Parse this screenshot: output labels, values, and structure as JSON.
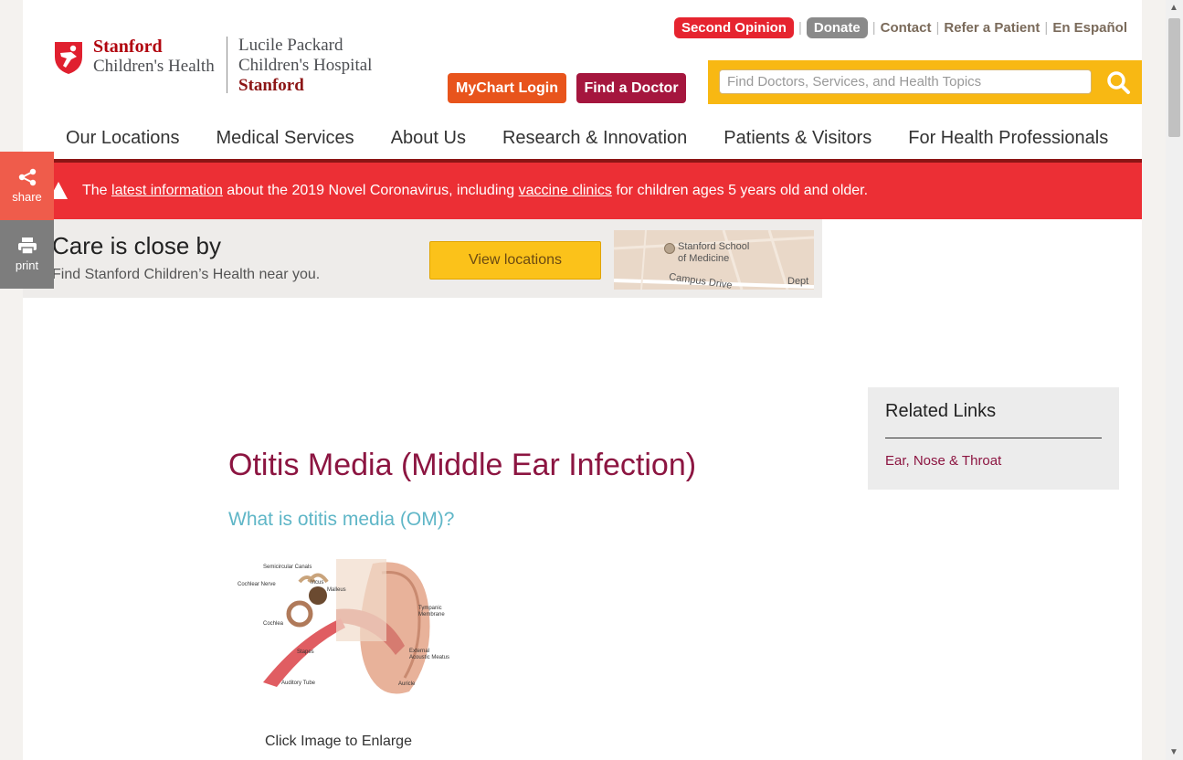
{
  "logo": {
    "sch_line1": "Stanford",
    "sch_line2": "Children's Health",
    "lpch_line1": "Lucile Packard",
    "lpch_line2": "Children's Hospital",
    "lpch_line3": "Stanford"
  },
  "utility": {
    "second_opinion": "Second Opinion",
    "donate": "Donate",
    "contact": "Contact",
    "refer": "Refer a Patient",
    "espanol": "En Español"
  },
  "buttons": {
    "mychart": "MyChart Login",
    "find_doctor": "Find a Doctor"
  },
  "search": {
    "placeholder": "Find Doctors, Services, and Health Topics"
  },
  "nav": {
    "items": [
      "Our Locations",
      "Medical Services",
      "About Us",
      "Research & Innovation",
      "Patients & Visitors",
      "For Health Professionals"
    ]
  },
  "alert": {
    "pre": "The ",
    "link1": "latest information",
    "mid": " about the 2019 Novel Coronavirus, including ",
    "link2": "vaccine clinics",
    "post": " for children ages 5 years old and older."
  },
  "promo": {
    "title": "Care is close by",
    "subtitle": "Find Stanford Children’s Health near you.",
    "button": "View locations",
    "map_label1": "Stanford School",
    "map_label2": "of Medicine",
    "map_label3": "Campus Drive",
    "map_label4": "Dept"
  },
  "side": {
    "share": "share",
    "print": "print"
  },
  "article": {
    "title": "Otitis Media (Middle Ear Infection)",
    "subtitle": "What is otitis media (OM)?",
    "caption": "Click Image to Enlarge"
  },
  "ear_labels": {
    "semicircular": "Semicircular Canals",
    "incus": "Incus",
    "malleus": "Malleus",
    "cochlear_nerve": "Cochlear Nerve",
    "tympanic": "Tympanic",
    "membrane": "Membrane",
    "cochlea": "Cochlea",
    "stapes": "Stapes",
    "external": "External",
    "acoustic": "Acoustic Meatus",
    "auditory": "Auditory Tube",
    "auricle": "Auricle"
  },
  "related": {
    "title": "Related Links",
    "link": "Ear, Nose & Throat"
  },
  "colors": {
    "brand_red": "#8c1515",
    "alert_red": "#ec2f35",
    "title_crimson": "#8c1541",
    "subtitle_teal": "#5fb6c7",
    "search_yellow": "#f8b813"
  }
}
